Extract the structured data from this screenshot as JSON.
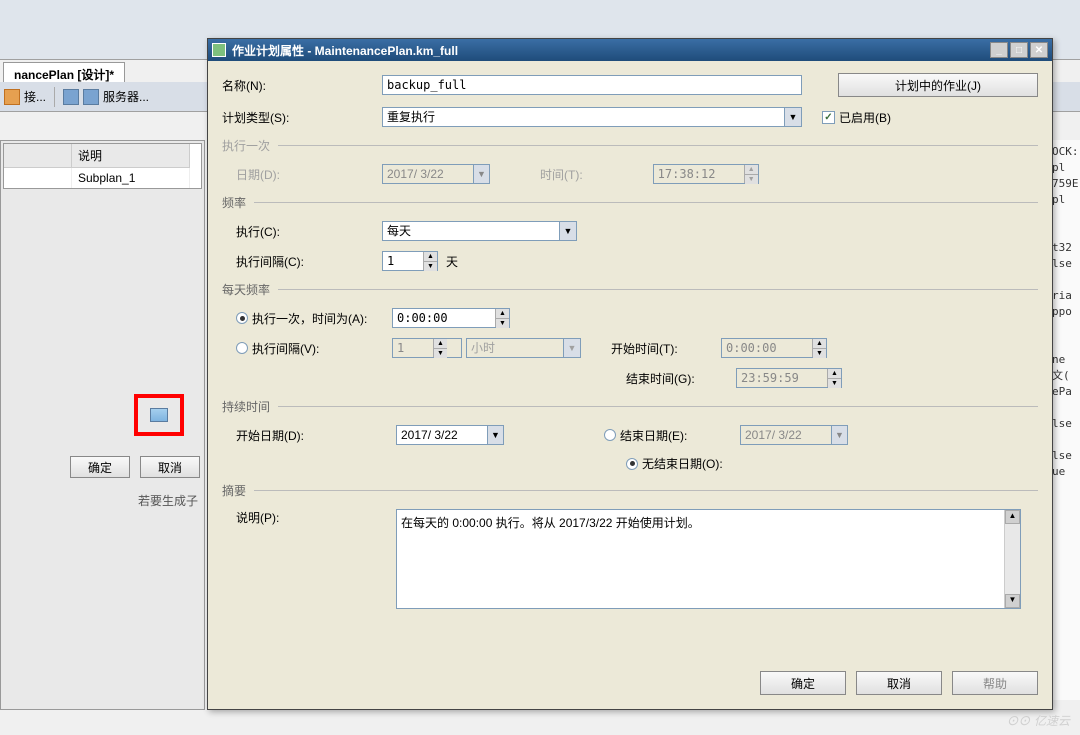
{
  "bg": {
    "tab_title": "nancePlan [设计]*",
    "connect": "接...",
    "servers": "服务器...",
    "col_desc": "说明",
    "subplan": "Subplan_1",
    "ok": "确定",
    "cancel": "取消",
    "gen_text": "若要生成子"
  },
  "dialog": {
    "title": "作业计划属性 - MaintenancePlan.km_full",
    "name_label": "名称(N):",
    "name_value": "backup_full",
    "jobs_btn": "计划中的作业(J)",
    "type_label": "计划类型(S):",
    "type_value": "重复执行",
    "enabled_label": "已启用(B)",
    "once_section": "执行一次",
    "date_label": "日期(D):",
    "date_value": "2017/ 3/22",
    "time_label": "时间(T):",
    "time_value": "17:38:12",
    "freq_section": "频率",
    "exec_label": "执行(C):",
    "exec_value": "每天",
    "interval_label": "执行间隔(C):",
    "interval_value": "1",
    "interval_unit": "天",
    "daily_section": "每天频率",
    "once_at_label": "执行一次，时间为(A):",
    "once_at_value": "0:00:00",
    "repeat_label": "执行间隔(V):",
    "repeat_value": "1",
    "repeat_unit": "小时",
    "start_time_label": "开始时间(T):",
    "start_time_value": "0:00:00",
    "end_time_label": "结束时间(G):",
    "end_time_value": "23:59:59",
    "duration_section": "持续时间",
    "start_date_label": "开始日期(D):",
    "start_date_value": "2017/ 3/22",
    "end_date_label": "结束日期(E):",
    "end_date_value": "2017/ 3/22",
    "no_end_label": "无结束日期(O):",
    "summary_section": "摘要",
    "desc_label": "说明(P):",
    "desc_value": "在每天的 0:00:00 执行。将从 2017/3/22 开始使用计划。",
    "ok": "确定",
    "cancel": "取消",
    "help": "帮助"
  },
  "watermark": "亿速云",
  "right_snips": "OCK:\npl\n759E\npl\n\n\nt32\nlse\n\nria\nppo\n\n\nne\n文(\nePa\n\nlse\n\nlse\nue"
}
